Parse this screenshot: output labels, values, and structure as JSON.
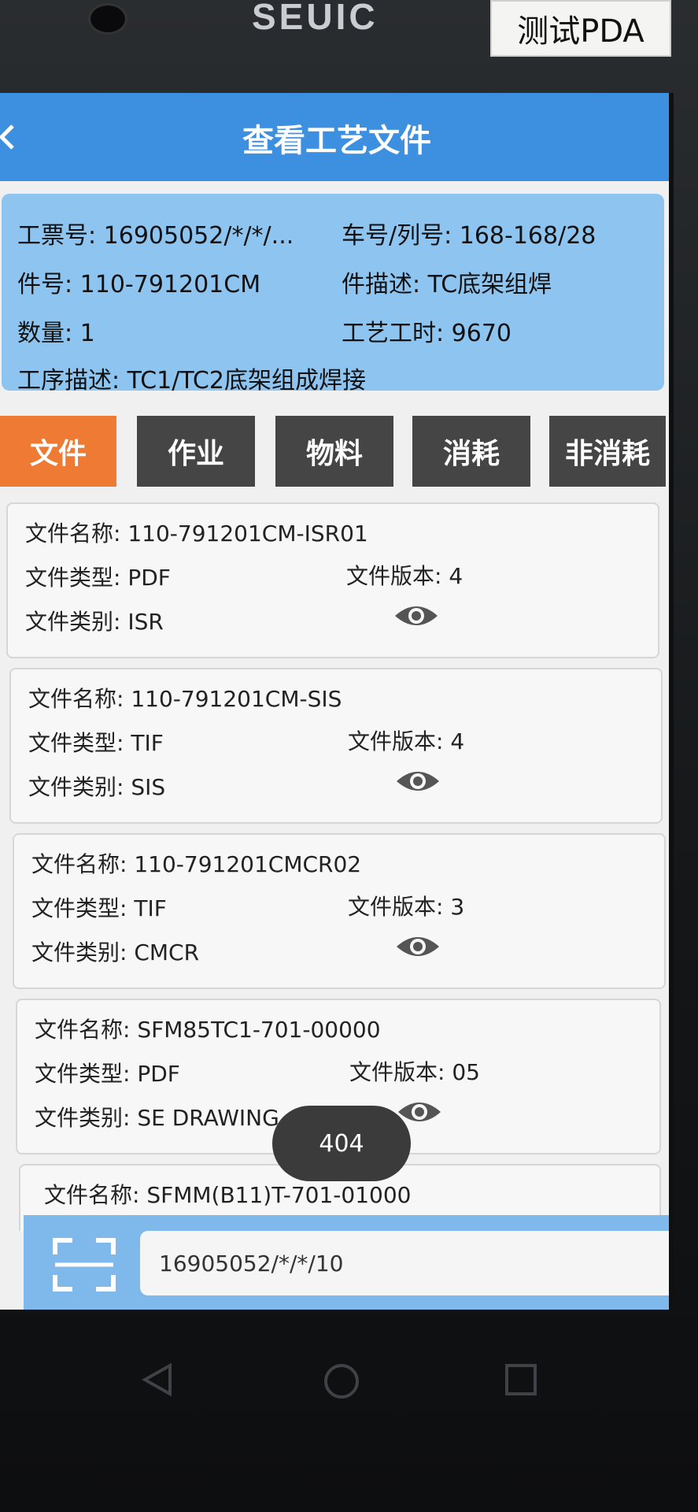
{
  "device": {
    "brand": "SEUIC",
    "sticker_label": "测试PDA"
  },
  "header": {
    "title": "查看工艺文件"
  },
  "info": {
    "ticket_no": "工票号: 16905052/*/*/...",
    "car_no": "车号/列号: 168-168/28",
    "part_no": "件号: 110-791201CM",
    "part_desc": "件描述: TC底架组焊",
    "quantity": "数量: 1",
    "process_hours": "工艺工时: 9670",
    "operation_desc": "工序描述: TC1/TC2底架组成焊接"
  },
  "tabs": [
    {
      "label": "文件",
      "active": true
    },
    {
      "label": "作业",
      "active": false
    },
    {
      "label": "物料",
      "active": false
    },
    {
      "label": "消耗",
      "active": false
    },
    {
      "label": "非消耗",
      "active": false
    }
  ],
  "files": [
    {
      "name": "文件名称: 110-791201CM-ISR01",
      "type": "文件类型: PDF",
      "version": "文件版本: 4",
      "category": "文件类别: ISR"
    },
    {
      "name": "文件名称: 110-791201CM-SIS",
      "type": "文件类型: TIF",
      "version": "文件版本: 4",
      "category": "文件类别: SIS"
    },
    {
      "name": "文件名称: 110-791201CMCR02",
      "type": "文件类型: TIF",
      "version": "文件版本: 3",
      "category": "文件类别: CMCR"
    },
    {
      "name": "文件名称: SFM85TC1-701-00000",
      "type": "文件类型: PDF",
      "version": "文件版本: 05",
      "category": "文件类别: SE DRAWING"
    },
    {
      "name": "文件名称: SFMM(B11)T-701-01000"
    }
  ],
  "toast": {
    "text": "404"
  },
  "scan": {
    "value": "16905052/*/*/10"
  },
  "icons": {
    "back": "chevron-left-icon",
    "view": "eye-icon",
    "scan": "scan-frame-icon",
    "nav_back": "triangle-back-icon",
    "nav_home": "circle-home-icon",
    "nav_recent": "square-recent-icon"
  },
  "colors": {
    "appbar": "#3d8fe0",
    "info_panel": "#8ec5f0",
    "tab_active": "#ef7a34",
    "tab_inactive": "#454545"
  }
}
